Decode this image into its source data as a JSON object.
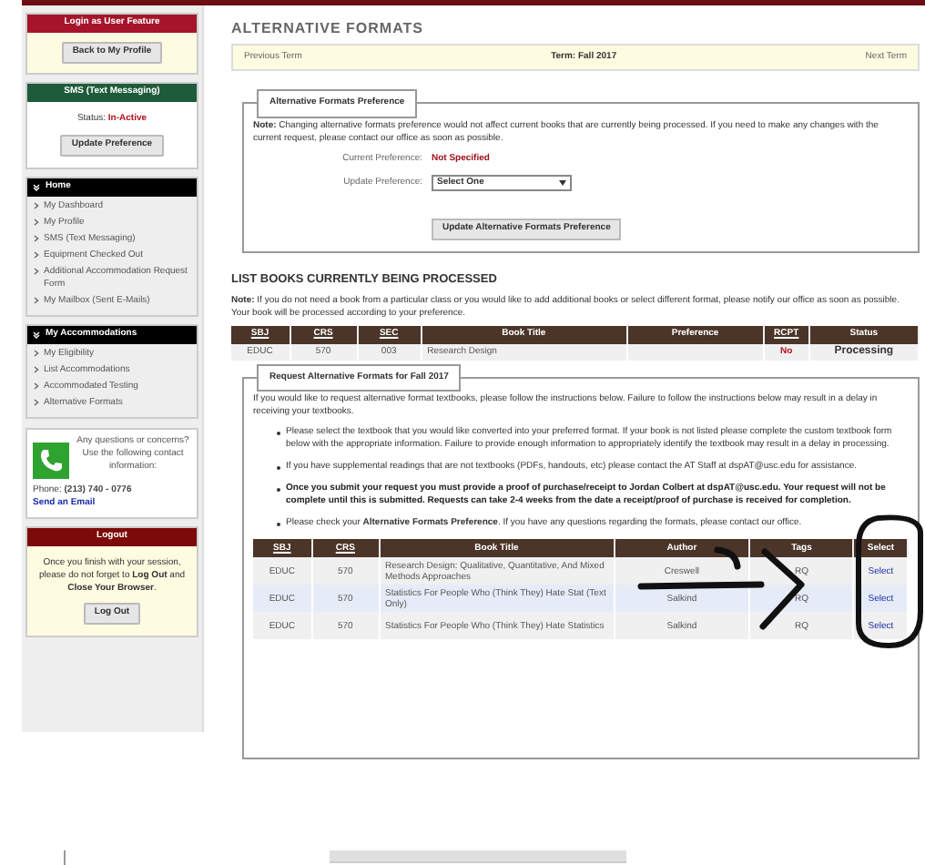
{
  "sidebar": {
    "panels": [
      {
        "kind": "button",
        "header": "Login as User Feature",
        "button": "Back to My Profile"
      },
      {
        "kind": "status",
        "header": "SMS (Text Messaging)",
        "status_label": "Status:",
        "status_value": "In-Active",
        "button": "Update Preference"
      },
      {
        "kind": "menu",
        "header": "Home",
        "items": [
          "My Dashboard",
          "My Profile",
          "SMS (Text Messaging)",
          "Equipment Checked Out",
          "Additional Accommodation Request Form",
          "My Mailbox (Sent E-Mails)"
        ]
      },
      {
        "kind": "menu",
        "header": "My Accommodations",
        "items": [
          "My Eligibility",
          "List Accommodations",
          "Accommodated Testing",
          "Alternative Formats"
        ]
      },
      {
        "kind": "contact",
        "text": "Any questions or concerns? Use the following contact information:",
        "phone": "Phone: **(213) 740 - 0776**",
        "link": "Send an Email"
      },
      {
        "kind": "logout",
        "header": "Logout",
        "text": "Once you finish with your session, please do not forget to **Log Out** and **Close Your Browser**.",
        "button": "Log Out"
      }
    ]
  },
  "main": {
    "title": "ALTERNATIVE FORMATS",
    "term_bar": {
      "previous": "Previous Term",
      "term": "Term: Fall 2017",
      "next": "Next Term"
    },
    "preference": {
      "legend": "Alternative Formats Preference",
      "note": "**Note:** Changing alternative formats preference would not affect current books that are currently being processed. If you need to make any changes with the current request, please contact our office as soon as possible.",
      "current_label": "Current Preference:",
      "current_value": "Not Specified",
      "update_label": "Update Preference:",
      "select_value": "Select One",
      "button": "Update Alternative Formats Preference"
    },
    "processing": {
      "title": "LIST BOOKS CURRENTLY BEING PROCESSED",
      "note": "**Note:** If you do not need a book from a particular class or you would like to add additional books or select different format, please notify our office as soon as possible. Your book will be processed according to your preference.",
      "columns": [
        {
          "label": "SBJ",
          "sortable": true
        },
        {
          "label": "CRS",
          "sortable": true
        },
        {
          "label": "SEC",
          "sortable": true
        },
        {
          "label": "Book Title",
          "sortable": false
        },
        {
          "label": "Preference",
          "sortable": false
        },
        {
          "label": "RCPT",
          "sortable": true
        },
        {
          "label": "Status",
          "sortable": false
        }
      ],
      "rows": [
        {
          "sbj": "EDUC",
          "crs": "570",
          "sec": "003",
          "title": "Research Design",
          "rcpt": "No",
          "status": "Processing"
        }
      ]
    },
    "request": {
      "legend": "Request Alternative Formats for Fall 2017",
      "intro": "If you would like to request alternative format textbooks, please follow the instructions below. Failure to follow the instructions below may result in a delay in receiving your textbooks.",
      "bullets": [
        {
          "text": "Please select the textbook that you would like converted into your preferred format. If your book is not listed please complete the custom textbook form below with the appropriate information. Failure to provide enough information to appropriately identify the textbook may result in a delay in processing.",
          "bold": false
        },
        {
          "text": "If you have supplemental readings that are not textbooks (PDFs, handouts, etc) please contact the AT Staff at dspAT@usc.edu for assistance.",
          "bold": false
        },
        {
          "text": "Once you submit your request you must provide a proof of purchase/receipt to Jordan Colbert at dspAT@usc.edu. Your request will not be complete until this is submitted. Requests can take 2-4 weeks from the date a receipt/proof of purchase is received for completion.",
          "bold": true
        },
        {
          "text": "Please check your **Alternative Formats Preference**. If you have any questions regarding the formats, please contact our office.",
          "bold": false
        }
      ],
      "columns": [
        {
          "label": "SBJ",
          "sortable": true
        },
        {
          "label": "CRS",
          "sortable": true
        },
        {
          "label": "Book Title",
          "sortable": false
        },
        {
          "label": "Author",
          "sortable": false
        },
        {
          "label": "Tags",
          "sortable": false
        },
        {
          "label": "Select",
          "sortable": false
        }
      ],
      "rows": [
        {
          "sbj": "EDUC",
          "crs": "570",
          "title": "Research Design: Qualitative, Quantitative, And Mixed Methods Approaches",
          "author": "Creswell",
          "tags": "RQ",
          "select": "Select",
          "highlighted": false
        },
        {
          "sbj": "EDUC",
          "crs": "570",
          "title": "Statistics For People Who (Think They) Hate Stat (Text Only)",
          "author": "Salkind",
          "tags": "RQ",
          "select": "Select",
          "highlighted": true
        },
        {
          "sbj": "EDUC",
          "crs": "570",
          "title": "Statistics For People Who (Think They) Hate Statistics",
          "author": "Salkind",
          "tags": "RQ",
          "select": "Select",
          "highlighted": false
        }
      ]
    }
  }
}
